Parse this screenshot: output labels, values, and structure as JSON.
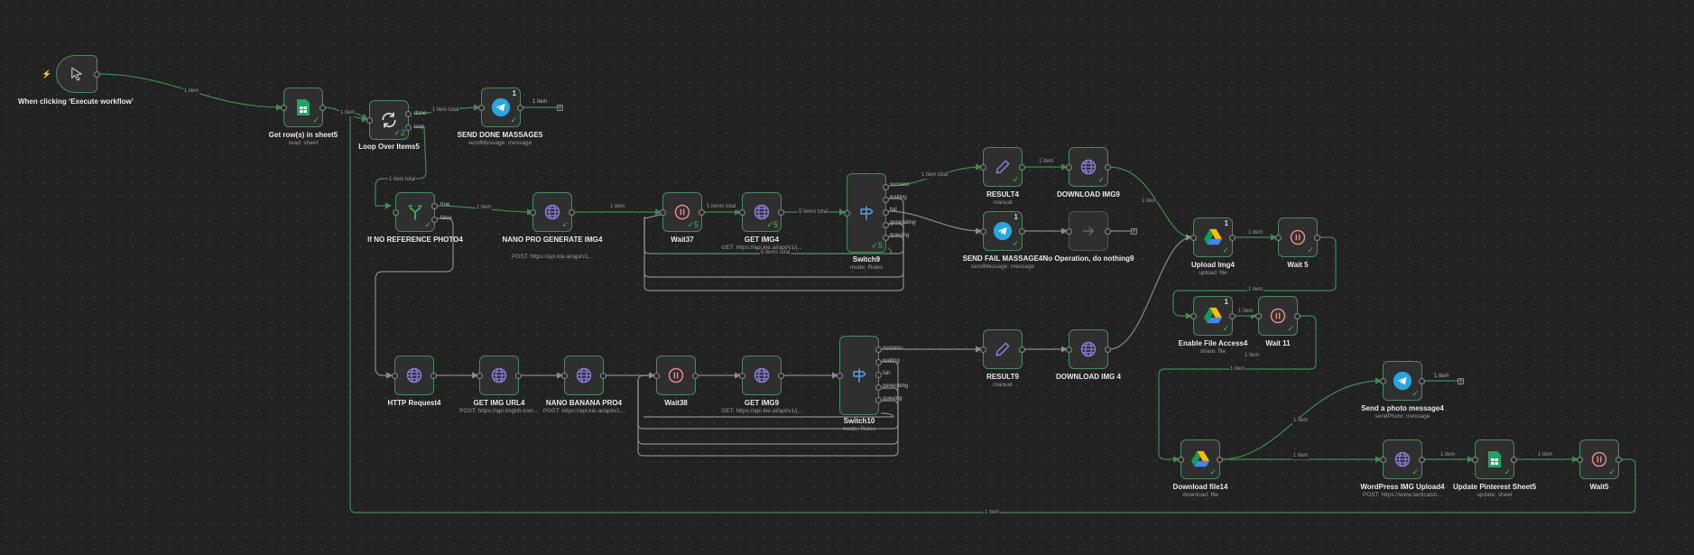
{
  "colors": {
    "background": "#222222",
    "edge": "#3f8a57",
    "edge_idle": "#8a8a8a",
    "node_border": "#4b8a5e",
    "success": "#3dbb6a"
  },
  "nodes": {
    "n1": {
      "title": "When clicking ‘Execute workflow’",
      "sub": "",
      "icon": "cursor-icon"
    },
    "n2": {
      "title": "Get row(s) in sheet5",
      "sub": "read: sheet",
      "icon": "sheets-icon"
    },
    "n3": {
      "title": "Loop Over Items5",
      "sub": "",
      "icon": "loop-icon"
    },
    "n4": {
      "title": "SEND DONE MASSAGE5",
      "sub": "sendMessage: message",
      "icon": "telegram-icon",
      "badge": "1"
    },
    "n5": {
      "title": "If NO REFERENCE PHOTO4",
      "sub": "",
      "icon": "if-icon"
    },
    "n6": {
      "title": "NANO PRO GENERATE IMG4",
      "sub": "POST: https://api.kie.ai/api/v1...",
      "icon": "globe-icon"
    },
    "n7": {
      "title": "Wait37",
      "sub": "",
      "icon": "pause-icon",
      "badge2": "5"
    },
    "n8": {
      "title": "GET IMG4",
      "sub": "GET: https://api.kie.ai/api/v1/j...",
      "icon": "globe-icon",
      "badge2": "5"
    },
    "n9": {
      "title": "Switch9",
      "sub": "mode: Rules",
      "icon": "switch-icon",
      "badge2": "5"
    },
    "n10": {
      "title": "RESULT4",
      "sub": "manual",
      "icon": "pencil-icon"
    },
    "n11": {
      "title": "DOWNLOAD IMG9",
      "sub": "",
      "icon": "globe-icon"
    },
    "n12": {
      "title": "SEND FAIL MASSAGE4",
      "sub": "sendMessage: message",
      "icon": "telegram-icon",
      "badge": "1"
    },
    "n13": {
      "title": "No Operation, do nothing9",
      "sub": "",
      "icon": "arrow-right-icon"
    },
    "n14": {
      "title": "Upload Img4",
      "sub": "upload: file",
      "icon": "drive-icon",
      "badge": "1"
    },
    "n15": {
      "title": "Wait 5",
      "sub": "",
      "icon": "pause-icon"
    },
    "n16": {
      "title": "Enable File Access4",
      "sub": "share: file",
      "icon": "drive-icon",
      "badge": "1"
    },
    "n17": {
      "title": "Wait 11",
      "sub": "",
      "icon": "pause-icon"
    },
    "n18": {
      "title": "HTTP Request4",
      "sub": "",
      "icon": "globe-icon"
    },
    "n19": {
      "title": "GET IMG URL4",
      "sub": "POST: https://api.imgbb.com...",
      "icon": "globe-icon"
    },
    "n20": {
      "title": "NANO BANANA PRO4",
      "sub": "POST: https://api.kie.ai/api/v1...",
      "icon": "globe-icon"
    },
    "n21": {
      "title": "Wait38",
      "sub": "",
      "icon": "pause-icon"
    },
    "n22": {
      "title": "GET IMG9",
      "sub": "GET: https://api.kie.ai/api/v1/j...",
      "icon": "globe-icon"
    },
    "n23": {
      "title": "Switch10",
      "sub": "mode: Rules",
      "icon": "switch-icon"
    },
    "n24": {
      "title": "RESULT9",
      "sub": "manual",
      "icon": "pencil-icon"
    },
    "n25": {
      "title": "DOWNLOAD IMG 4",
      "sub": "",
      "icon": "globe-icon"
    },
    "n26": {
      "title": "Send a photo message4",
      "sub": "sendPhoto: message",
      "icon": "telegram-icon"
    },
    "n27": {
      "title": "Download file14",
      "sub": "download: file",
      "icon": "drive-icon"
    },
    "n28": {
      "title": "WordPress IMG Upload4",
      "sub": "POST: https://www.tacticalsh...",
      "icon": "globe-icon"
    },
    "n29": {
      "title": "Update Pinterest Sheet5",
      "sub": "update: sheet",
      "icon": "sheets-icon"
    },
    "n30": {
      "title": "Wait5",
      "sub": "",
      "icon": "pause-icon"
    }
  },
  "outputs": {
    "loop_done": "done",
    "loop_loop": "loop",
    "if_true": "true",
    "if_false": "false",
    "sw_success": "success",
    "sw_waiting": "waiting",
    "sw_fail": "fail",
    "sw_generating": "generating",
    "sw_queuing": "queuing"
  },
  "edge_labels": {
    "e1": "1 item",
    "e2": "1 item",
    "e3": "1 item total",
    "e4": "1 item total",
    "e5": "1 item",
    "e6": "1 item",
    "e7": "5 items total",
    "e8": "5 items total",
    "e9": "5 items total",
    "e10": "1 item total",
    "e11": "1 item",
    "e12": "1 item",
    "e13": "1 item",
    "e14": "1 item",
    "e15": "1 item",
    "e16": "1 item",
    "e17": "1 item",
    "e18": "1 item",
    "e19": "1 item",
    "e20": "1 item",
    "e21": "1 item",
    "e22": "1 item"
  },
  "output_items": {
    "o1": "1 item",
    "o2": "1 item"
  }
}
